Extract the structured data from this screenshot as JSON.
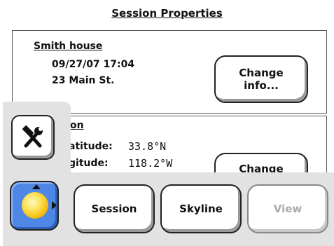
{
  "header": {
    "title": "Session Properties"
  },
  "session_panel": {
    "name": "Smith house",
    "datetime": "09/27/07 17:04",
    "address": "23 Main St.",
    "change_button": "Change info..."
  },
  "location_panel": {
    "title_partial": "on",
    "latitude_label": "atitude:",
    "latitude_value": "33.8°N",
    "longitude_label": "gitude:",
    "longitude_value": "118.2°W",
    "change_button": "Change"
  },
  "toolbar": {
    "session_label": "Session",
    "skyline_label": "Skyline",
    "view_label": "View"
  },
  "icons": {
    "tools": "tools-icon",
    "sun": "sun-icon"
  },
  "colors": {
    "sun_button_bg": "#4f87e6",
    "toolbar_bg": "#e2e2e2",
    "disabled_text": "#aaaaaa"
  }
}
